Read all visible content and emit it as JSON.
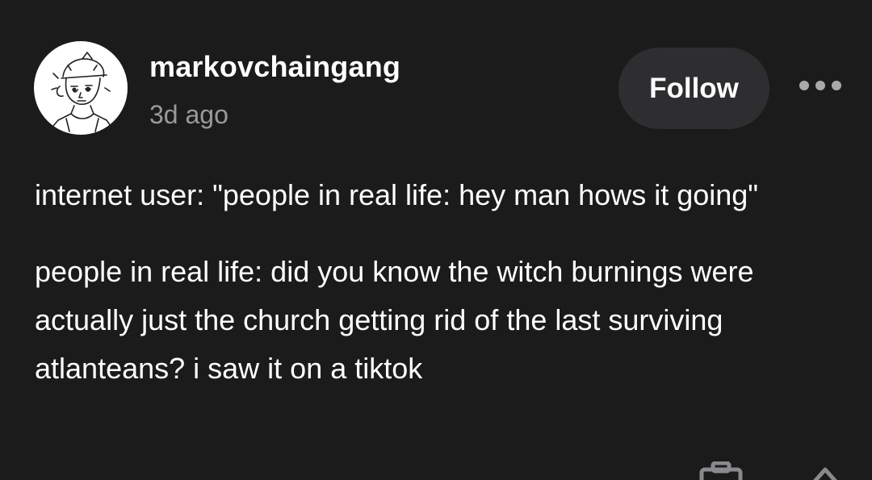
{
  "post": {
    "author": {
      "username": "markovchaingang",
      "timestamp": "3d ago",
      "avatar_icon": "sketch-avatar-icon"
    },
    "follow_label": "Follow",
    "more_icon": "more-options-icon",
    "paragraphs": [
      "internet user: \"people in real life: hey man hows it going\"",
      "people in real life: did you know the witch burnings were actually just the church getting rid of the last surviving atlanteans? i saw it on a tiktok"
    ],
    "footer_icons": [
      "briefcase-icon",
      "home-icon"
    ]
  },
  "colors": {
    "background": "#1b1b1c",
    "button_bg": "#2e2e30",
    "muted_text": "#9a9a9c",
    "text": "#ffffff"
  }
}
